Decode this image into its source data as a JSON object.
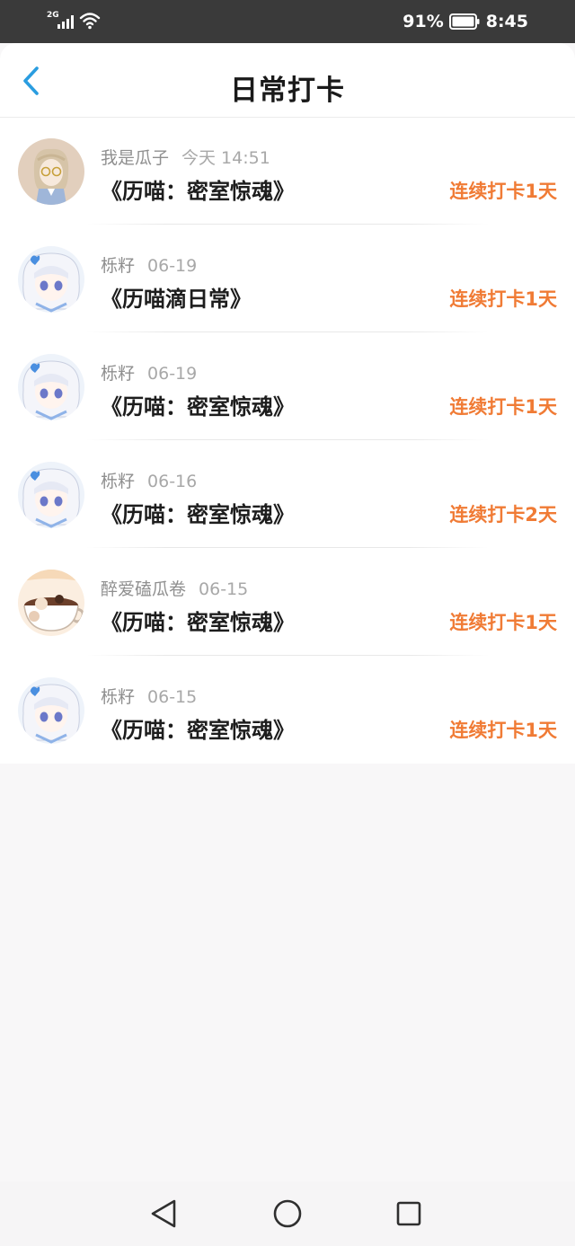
{
  "status_bar": {
    "network": "2G",
    "battery": "91%",
    "time": "8:45"
  },
  "header": {
    "title": "日常打卡"
  },
  "checkins": [
    {
      "user": "我是瓜子",
      "time": "今天 14:51",
      "book": "《历喵：密室惊魂》",
      "streak": "连续打卡1天",
      "avatar": "glasses-character-avatar"
    },
    {
      "user": "栎籽",
      "time": "06-19",
      "book": "《历喵滴日常》",
      "streak": "连续打卡1天",
      "avatar": "white-hair-anime-avatar"
    },
    {
      "user": "栎籽",
      "time": "06-19",
      "book": "《历喵：密室惊魂》",
      "streak": "连续打卡1天",
      "avatar": "white-hair-anime-avatar"
    },
    {
      "user": "栎籽",
      "time": "06-16",
      "book": "《历喵：密室惊魂》",
      "streak": "连续打卡2天",
      "avatar": "white-hair-anime-avatar"
    },
    {
      "user": "醉爱磕瓜卷",
      "time": "06-15",
      "book": "《历喵：密室惊魂》",
      "streak": "连续打卡1天",
      "avatar": "coffee-cup-avatar"
    },
    {
      "user": "栎籽",
      "time": "06-15",
      "book": "《历喵：密室惊魂》",
      "streak": "连续打卡1天",
      "avatar": "white-hair-anime-avatar"
    }
  ],
  "nav": {
    "back": "back-triangle-icon",
    "home": "home-circle-icon",
    "recents": "recents-square-icon"
  },
  "colors": {
    "accent": "#f07b35",
    "back_arrow": "#2a9de0",
    "status_bar": "#3a3a3a"
  }
}
